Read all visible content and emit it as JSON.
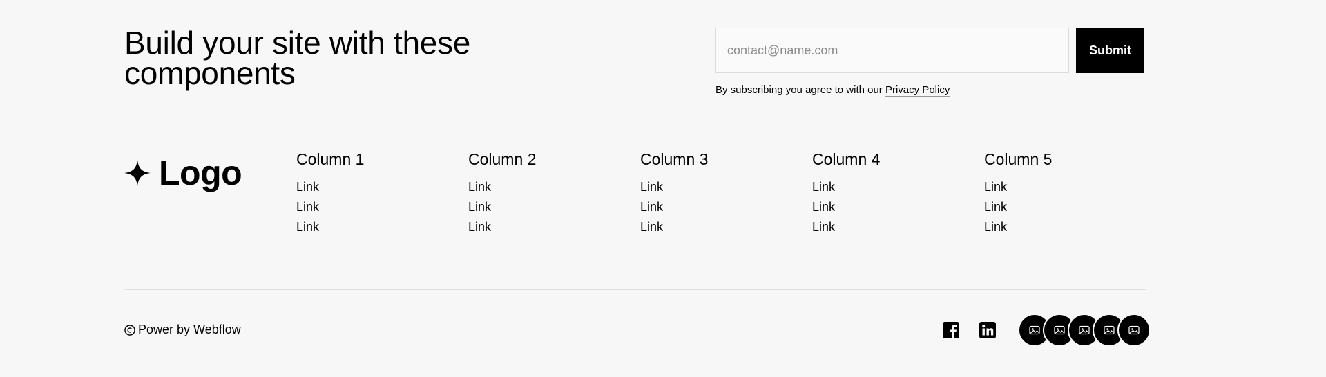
{
  "headline": "Build your site with these components",
  "signup": {
    "email_placeholder": "contact@name.com",
    "email_value": "",
    "submit_label": "Submit",
    "consent_text": "By subscribing you agree to with our ",
    "privacy_link": "Privacy Policy"
  },
  "logo": {
    "text": "Logo",
    "icon": "sparkle-icon"
  },
  "columns": [
    {
      "title": "Column 1",
      "links": [
        "Link",
        "Link",
        "Link"
      ]
    },
    {
      "title": "Column 2",
      "links": [
        "Link",
        "Link",
        "Link"
      ]
    },
    {
      "title": "Column 3",
      "links": [
        "Link",
        "Link",
        "Link"
      ]
    },
    {
      "title": "Column 4",
      "links": [
        "Link",
        "Link",
        "Link"
      ]
    },
    {
      "title": "Column 5",
      "links": [
        "Link",
        "Link",
        "Link"
      ]
    }
  ],
  "footer": {
    "copyright_symbol_icon": "copyright-icon",
    "copyright_text": "Power by Webflow",
    "social_icons": [
      "facebook-icon",
      "linkedin-icon"
    ],
    "avatar_icons": [
      "image-placeholder-icon",
      "image-placeholder-icon",
      "image-placeholder-icon",
      "image-placeholder-icon",
      "image-placeholder-icon"
    ]
  },
  "colors": {
    "background": "#f7f7f7",
    "text": "#000000",
    "button_bg": "#000000",
    "button_text": "#ffffff",
    "divider": "#e0e0e0"
  }
}
